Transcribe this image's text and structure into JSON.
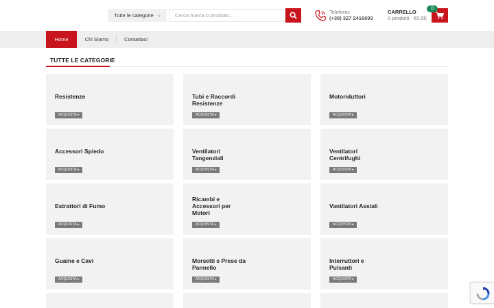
{
  "header": {
    "category_select": {
      "label": "Tutte le categorie"
    },
    "search": {
      "placeholder": "Cerca marca o prodotto..."
    },
    "phone": {
      "label": "Telefono:",
      "number": "(+39) 327 2416693"
    },
    "cart": {
      "title": "CARRELLO",
      "summary": "0 prodotti - €0.00",
      "count": "0"
    }
  },
  "nav": {
    "items": [
      {
        "label": "Home",
        "active": true
      },
      {
        "label": "Chi Siamo"
      },
      {
        "label": "Contattaci"
      }
    ]
  },
  "section": {
    "title": "TUTTE LE CATEGORIE"
  },
  "buy_label": "ACQUISTA",
  "categories": [
    {
      "name": "Resistenze"
    },
    {
      "name": "Tubi e Raccordi Resistenze"
    },
    {
      "name": "Motoriduttori"
    },
    {
      "name": "Accessori Spiedo"
    },
    {
      "name": "Ventilatori Tangenziali"
    },
    {
      "name": "Ventilatori Centrifughi"
    },
    {
      "name": "Estrattori di Fumo"
    },
    {
      "name": "Ricambi e Accessori per Motori"
    },
    {
      "name": "Vantilatori Assiali"
    },
    {
      "name": "Guaine e Cavi"
    },
    {
      "name": "Morsetti e Prese da Pannello"
    },
    {
      "name": "Interruttori e Pulsanti"
    }
  ],
  "colors": {
    "accent": "#c8141c",
    "badge": "#1d8a5a",
    "card": "#f2f2f2",
    "nav": "#eeeeee"
  },
  "icons": [
    "search-icon",
    "phone-icon",
    "cart-icon",
    "chevron-down-icon",
    "recaptcha-icon"
  ]
}
